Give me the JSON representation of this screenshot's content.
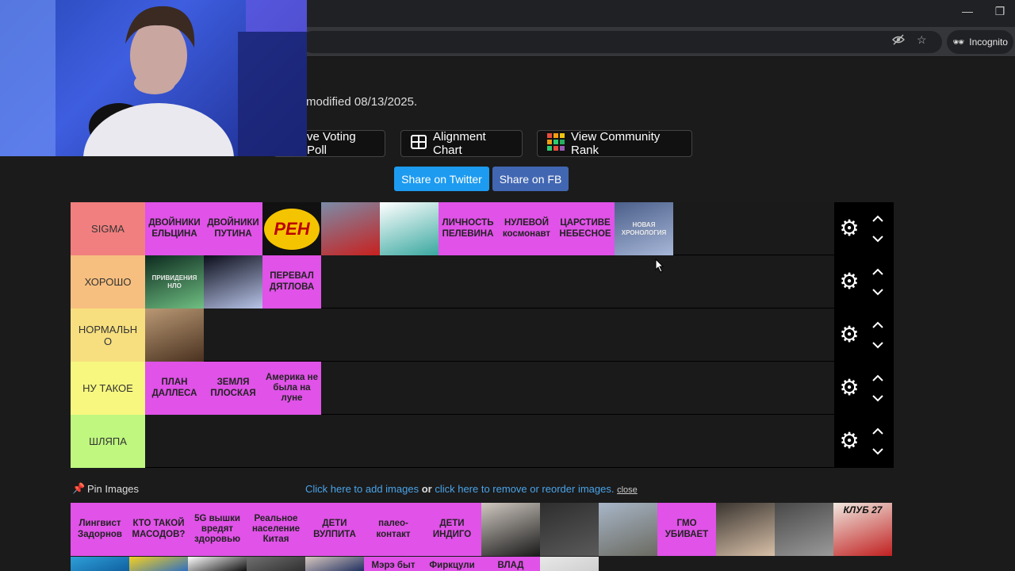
{
  "browser": {
    "incognito_label": "Incognito",
    "minimize_glyph": "—",
    "restore_glyph": "❐"
  },
  "page": {
    "modified_text": "modified 08/13/2025.",
    "buttons": {
      "voting_poll": "ve Voting Poll",
      "alignment_chart": "Alignment Chart",
      "community_rank": "View Community Rank"
    },
    "share": {
      "twitter": "Share on Twitter",
      "fb": "Share on FB"
    }
  },
  "tiers": [
    {
      "label": "SIGMA",
      "color": "#f27f7f",
      "items": [
        {
          "type": "text",
          "text": "ДВОЙНИКИ ЕЛЬЦИНА"
        },
        {
          "type": "text",
          "text": "ДВОЙНИКИ ПУТИНА"
        },
        {
          "type": "image",
          "name": "ren-tv-logo-image",
          "text": "РЕН"
        },
        {
          "type": "image",
          "name": "politician-red-jacket-image"
        },
        {
          "type": "image",
          "name": "minecraft-herobrine-image"
        },
        {
          "type": "text",
          "text": "ЛИЧНОСТЬ ПЕЛЕВИНА"
        },
        {
          "type": "text",
          "text": "НУЛЕВОЙ космонавт"
        },
        {
          "type": "text",
          "text": "ЦАРСТИВЕ НЕБЕСНОЕ"
        },
        {
          "type": "image",
          "name": "book-cover-image",
          "text": "НОВАЯ ХРОНОЛОГИЯ"
        }
      ]
    },
    {
      "label": "ХОРОШО",
      "color": "#f7bf7f",
      "items": [
        {
          "type": "image",
          "name": "ghosts-poster-image",
          "text": "ПРИВИДЕНИЯ НЛО"
        },
        {
          "type": "image",
          "name": "ufo-beam-image"
        },
        {
          "type": "text",
          "text": "ПЕРЕВАЛ ДЯТЛОВА"
        }
      ]
    },
    {
      "label": "НОРМАЛЬН О",
      "color": "#f7df7f",
      "items": [
        {
          "type": "image",
          "name": "werewolf-image"
        }
      ]
    },
    {
      "label": "НУ ТАКОЕ",
      "color": "#f7f77f",
      "items": [
        {
          "type": "text",
          "text": "ПЛАН ДАЛЛЕСА"
        },
        {
          "type": "text",
          "text": "ЗЕМЛЯ ПЛОСКАЯ"
        },
        {
          "type": "text",
          "text": "Америка не была на луне"
        }
      ]
    },
    {
      "label": "ШЛЯПА",
      "color": "#bff77f",
      "items": []
    }
  ],
  "pin": {
    "title": "Pin Images",
    "add_link": "Click here to add images",
    "or_text": "or",
    "remove_link": "click here to remove or reorder images.",
    "close": "close"
  },
  "pool": [
    {
      "type": "text",
      "text": "Лингвист Задорнов"
    },
    {
      "type": "text",
      "text": "КТО ТАКОЙ МАСОДОВ?"
    },
    {
      "type": "text",
      "text": "5G вышки вредят здоровью"
    },
    {
      "type": "text",
      "text": "Реальное население Китая"
    },
    {
      "type": "text",
      "text": "ДЕТИ ВУЛПИТА"
    },
    {
      "type": "text",
      "text": "палео-контакт"
    },
    {
      "type": "text",
      "text": "ДЕТИ ИНДИГО"
    },
    {
      "type": "image",
      "name": "michael-jackson-image"
    },
    {
      "type": "image",
      "name": "dark-forest-image"
    },
    {
      "type": "image",
      "name": "chernobyl-image"
    },
    {
      "type": "text",
      "text": "ГМО УБИВАЕТ"
    },
    {
      "type": "image",
      "name": "harry-potter-image"
    },
    {
      "type": "image",
      "name": "alien-creature-image"
    },
    {
      "type": "image",
      "name": "club-27-image",
      "text": "КЛУБ 27"
    }
  ],
  "pool2": [
    {
      "type": "image",
      "name": "blue-creature-image"
    },
    {
      "type": "image",
      "name": "simpsons-image"
    },
    {
      "type": "image",
      "name": "number-image"
    },
    {
      "type": "image",
      "name": "cat-image"
    },
    {
      "type": "image",
      "name": "man-portrait-image"
    },
    {
      "type": "text",
      "text": "Мэрэ быт"
    },
    {
      "type": "text",
      "text": "Фиркцули"
    },
    {
      "type": "text",
      "text": "ВЛАД"
    },
    {
      "type": "image",
      "name": "white-blob-image"
    }
  ]
}
